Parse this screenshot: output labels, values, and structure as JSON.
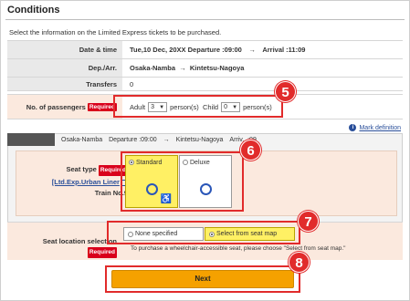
{
  "page": {
    "title": "Conditions",
    "intro": "Select the information on the Limited Express tickets to be purchased."
  },
  "summary": {
    "date_label": "Date & time",
    "date_value": "Tue,10 Dec, 20XX Departure :09:00　→　Arrival :11:09",
    "dep_label": "Dep./Arr.",
    "dep_from": "Osaka-Namba",
    "arrow": "→",
    "dep_to": "Kintetsu-Nagoya",
    "transfers_label": "Transfers",
    "transfers_value": "0"
  },
  "passengers": {
    "label": "No. of passengers",
    "required": "Required",
    "adult_label": "Adult",
    "adult_value": "3",
    "child_label": "Child",
    "child_value": "0",
    "unit": "person(s)"
  },
  "mark_definition": "Mark definition",
  "train": {
    "header": "Osaka-Namba　Departure :09:00　→　Kintetsu-Nagoya　Arriv...:09",
    "seat_type_label": "Seat type",
    "required": "Required",
    "train_name": "[Ltd.Exp.Urban Liner",
    "train_no": "Train No.9",
    "options": [
      {
        "label": "Standard",
        "selected": true
      },
      {
        "label": "Deluxe",
        "selected": false
      }
    ]
  },
  "location": {
    "label": "Seat location selection",
    "required": "Required",
    "options": [
      {
        "label": "None specified",
        "selected": false
      },
      {
        "label": "Select from seat map",
        "selected": true
      }
    ],
    "note": "To purchase a wheelchair-accessible seat, please choose \"Select from seat map.\""
  },
  "next_label": "Next",
  "callouts": [
    "5",
    "6",
    "7",
    "8"
  ],
  "colors": {
    "callout": "#e12b2b",
    "required": "#d9001b",
    "accent_button": "#f5a100",
    "selected": "#fff064"
  }
}
